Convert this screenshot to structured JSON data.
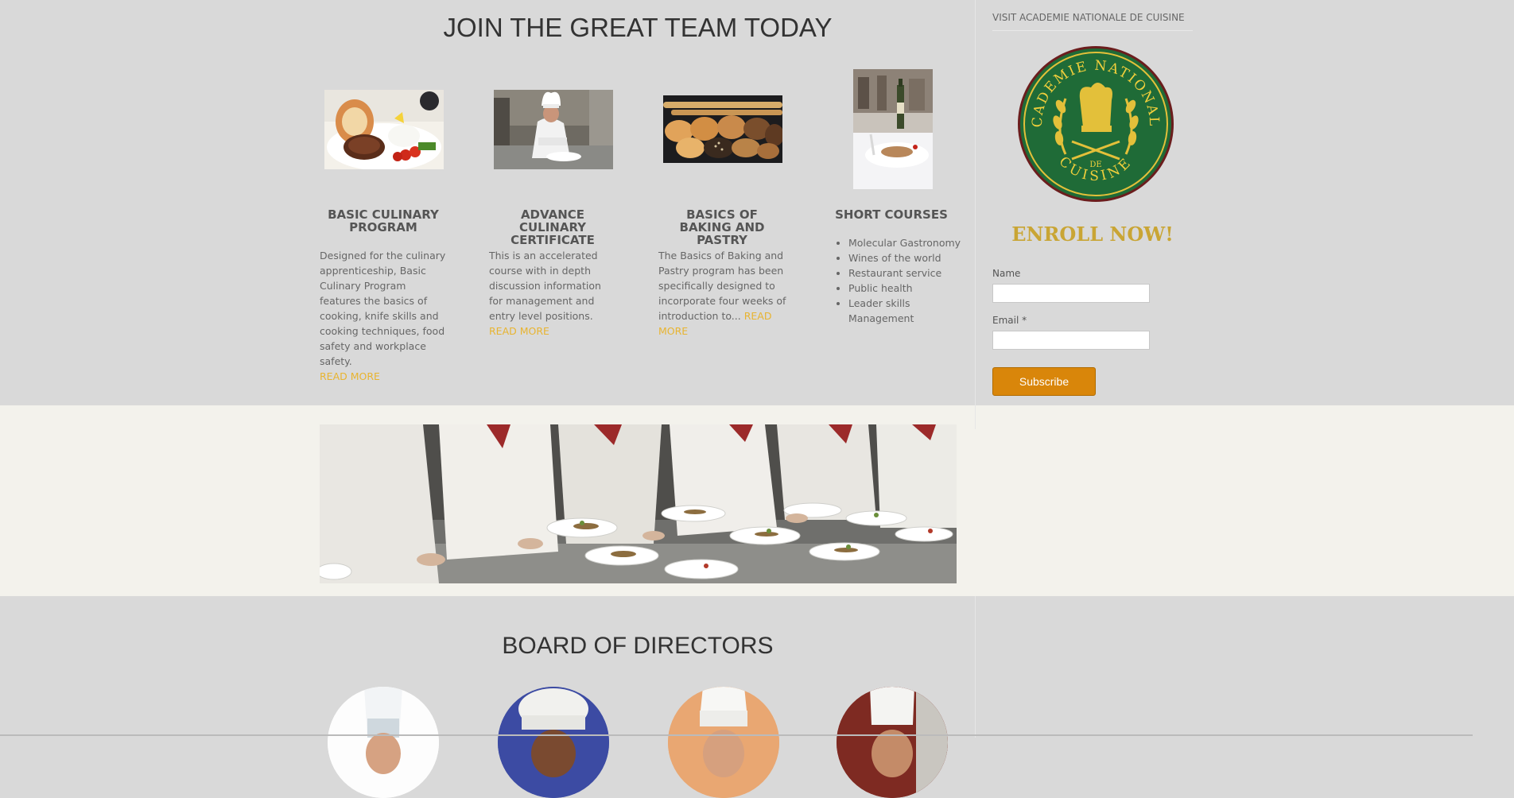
{
  "join": {
    "title": "JOIN THE GREAT TEAM TODAY",
    "columns": [
      {
        "title": "BASIC CULINARY PROGRAM",
        "text": "Designed for the culinary apprenticeship, Basic Culinary Program features the basics of cooking, knife skills and cooking techniques, food safety and workplace safety.",
        "link": " READ MORE",
        "image": "steak-plate-photo"
      },
      {
        "title": "ADVANCE CULINARY CERTIFICATE",
        "text": "This is an accelerated course with in depth discussion information for management and entry level positions.",
        "link": " READ MORE",
        "image": "chef-plating-photo"
      },
      {
        "title": "BASICS OF BAKING AND PASTRY",
        "text": "The Basics of Baking and Pastry program has been specifically designed to incorporate four weeks of introduction to...",
        "link": " READ MORE",
        "image": "bread-rolls-photo"
      },
      {
        "title": "SHORT COURSES",
        "items": [
          "Molecular Gastronomy",
          "Wines of the world",
          "Restaurant service",
          "Public health",
          "Leader skills Management"
        ],
        "image": "wine-dining-photo"
      }
    ]
  },
  "sidebar": {
    "title": "VISIT ACADEMIE NATIONALE DE CUISINE",
    "logo_text": "ACADEMIE NATIONALE DE CUISINE",
    "enroll": "ENROLL NOW!",
    "name_label": "Name",
    "email_label": "Email *",
    "subscribe": "Subscribe"
  },
  "board": {
    "title": "BOARD OF DIRECTORS"
  },
  "colors": {
    "accent_gold": "#e8b430",
    "button": "#d9860a",
    "band_grey": "#d9d9d9",
    "band_cream": "#f3f2ec",
    "seal_green": "#1f6b37"
  }
}
